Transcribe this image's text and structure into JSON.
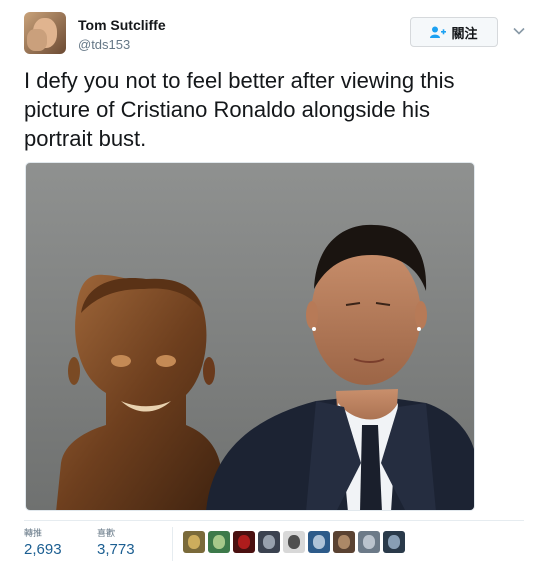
{
  "user": {
    "display_name": "Tom Sutcliffe",
    "handle": "@tds153"
  },
  "follow_button": {
    "label": "關注"
  },
  "tweet": {
    "lines": [
      "I defy you not to feel better after viewing this",
      "picture of Cristiano Ronaldo alongside his",
      "portrait bust."
    ]
  },
  "stats": {
    "retweets": {
      "label": "轉推",
      "value": "2,693"
    },
    "likes": {
      "label": "喜歡",
      "value": "3,773"
    }
  },
  "likers": [
    {
      "icon": "avatar-1",
      "bg": "#7a6a3a",
      "fg": "#e9c46a"
    },
    {
      "icon": "avatar-2",
      "bg": "#3d7a4a",
      "fg": "#c9e4a0"
    },
    {
      "icon": "avatar-3",
      "bg": "#4a1010",
      "fg": "#d02020"
    },
    {
      "icon": "avatar-4",
      "bg": "#3b4250",
      "fg": "#b7c0cc"
    },
    {
      "icon": "avatar-5",
      "bg": "#d8d8d8",
      "fg": "#222222"
    },
    {
      "icon": "avatar-6",
      "bg": "#2d5b8a",
      "fg": "#d9e6f2"
    },
    {
      "icon": "avatar-7",
      "bg": "#5a4232",
      "fg": "#c8a07a"
    },
    {
      "icon": "avatar-8",
      "bg": "#6c7a88",
      "fg": "#d4dce4"
    },
    {
      "icon": "avatar-9",
      "bg": "#2a3a4a",
      "fg": "#a8c0d8"
    }
  ],
  "colors": {
    "link_blue": "#1b5e91",
    "follow_icon_blue": "#1da1f2",
    "muted": "#657786"
  }
}
